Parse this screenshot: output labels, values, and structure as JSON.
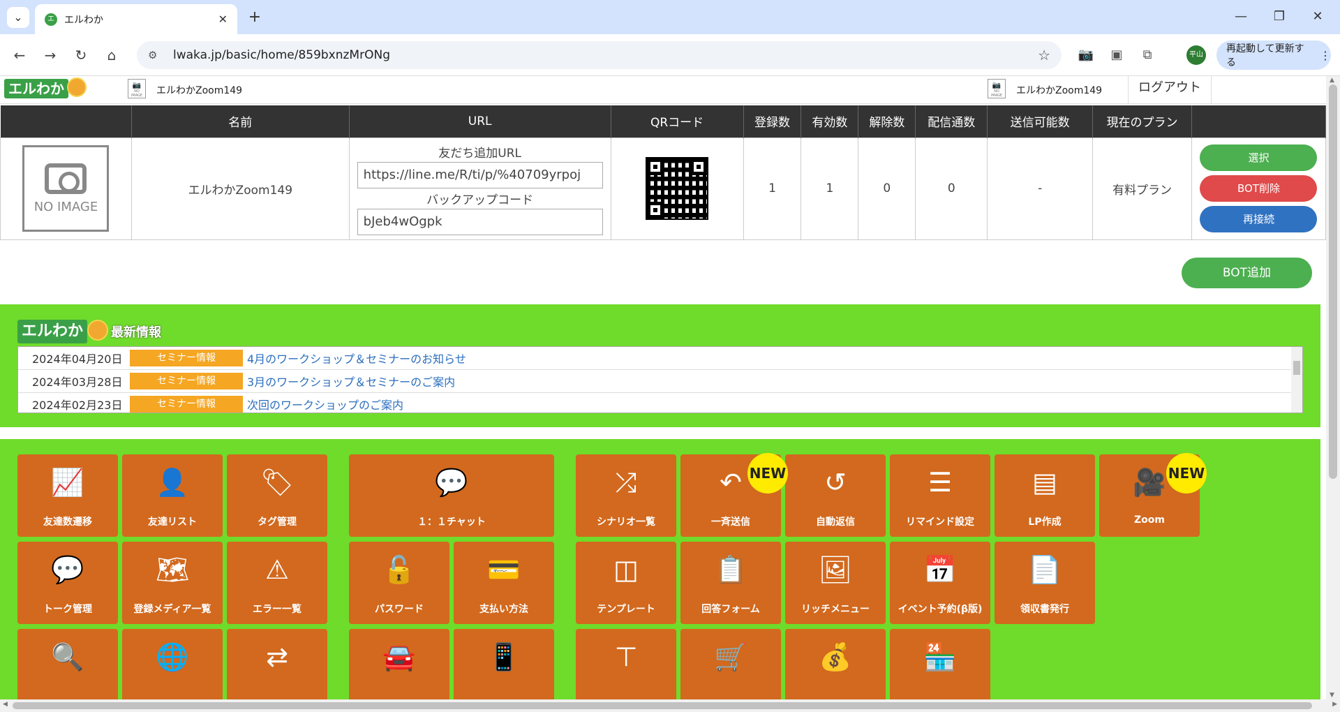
{
  "browser": {
    "tab_title": "エルわか",
    "tab_favicon": "エ",
    "url": "lwaka.jp/basic/home/859bxnzMrONg",
    "profile_initials": "平山",
    "relaunch_label": "再起動して更新する"
  },
  "header": {
    "logo_text": "エルわか",
    "account_name_left": "エルわかZoom149",
    "account_name_right": "エルわかZoom149",
    "noimage_label": "NO IMAGE",
    "logout_label": "ログアウト"
  },
  "bots_table": {
    "columns": [
      "",
      "名前",
      "URL",
      "QRコード",
      "登録数",
      "有効数",
      "解除数",
      "配信通数",
      "送信可能数",
      "現在のプラン",
      ""
    ],
    "row": {
      "image_label": "NO IMAGE",
      "name": "エルわかZoom149",
      "friend_url_label": "友だち追加URL",
      "friend_url": "https://line.me/R/ti/p/%40709yrpoj",
      "backup_label": "バックアップコード",
      "backup_code": "bJeb4wOgpk",
      "registered": "1",
      "active": "1",
      "unsubscribed": "0",
      "delivered": "0",
      "sendable": "-",
      "plan": "有料プラン",
      "select_label": "選択",
      "delete_label": "BOT削除",
      "reconnect_label": "再接続"
    },
    "add_bot_label": "BOT追加"
  },
  "news": {
    "logo_text": "エルわか",
    "heading": "最新情報",
    "items": [
      {
        "date": "2024年04月20日",
        "tag": "セミナー情報",
        "title": "4月のワークショップ＆セミナーのお知らせ"
      },
      {
        "date": "2024年03月28日",
        "tag": "セミナー情報",
        "title": "3月のワークショップ＆セミナーのご案内"
      },
      {
        "date": "2024年02月23日",
        "tag": "セミナー情報",
        "title": "次回のワークショップのご案内"
      }
    ]
  },
  "menu": {
    "new_badge": "NEW",
    "tiles": [
      {
        "label": "友達数遷移",
        "icon": "chart-line-icon",
        "glyph": "📈"
      },
      {
        "label": "友達リスト",
        "icon": "user-icon",
        "glyph": "👤"
      },
      {
        "label": "タグ管理",
        "icon": "tags-icon",
        "glyph": "🏷"
      },
      {
        "label": "１：１チャット",
        "icon": "chat-bubble-icon",
        "glyph": "💬"
      },
      {
        "label": "シナリオ一覧",
        "icon": "shuffle-icon",
        "glyph": "⤮"
      },
      {
        "label": "一斉送信",
        "icon": "reply-icon",
        "glyph": "↶"
      },
      {
        "label": "自動返信",
        "icon": "undo-icon",
        "glyph": "↺"
      },
      {
        "label": "リマインド設定",
        "icon": "list-icon",
        "glyph": "☰"
      },
      {
        "label": "LP作成",
        "icon": "webpage-icon",
        "glyph": "▤"
      },
      {
        "label": "Zoom",
        "icon": "video-camera-icon",
        "glyph": "🎥"
      },
      {
        "label": "トーク管理",
        "icon": "comment-icon",
        "glyph": "💬"
      },
      {
        "label": "登録メディア一覧",
        "icon": "map-icon",
        "glyph": "🗺"
      },
      {
        "label": "エラー一覧",
        "icon": "warning-icon",
        "glyph": "⚠"
      },
      {
        "label": "パスワード",
        "icon": "unlock-icon",
        "glyph": "🔓"
      },
      {
        "label": "支払い方法",
        "icon": "credit-card-icon",
        "glyph": "💳"
      },
      {
        "label": "テンプレート",
        "icon": "columns-icon",
        "glyph": "◫"
      },
      {
        "label": "回答フォーム",
        "icon": "clipboard-icon",
        "glyph": "📋"
      },
      {
        "label": "リッチメニュー",
        "icon": "image-icon",
        "glyph": "🖼"
      },
      {
        "label": "イベント予約(β版)",
        "icon": "calendar-icon",
        "glyph": "📅"
      },
      {
        "label": "領収書発行",
        "icon": "document-icon",
        "glyph": "📄"
      },
      {
        "label": "",
        "icon": "search-user-icon",
        "glyph": "🔍"
      },
      {
        "label": "",
        "icon": "www-icon",
        "glyph": "🌐"
      },
      {
        "label": "",
        "icon": "exchange-icon",
        "glyph": "⇄"
      },
      {
        "label": "",
        "icon": "car-icon",
        "glyph": "🚘"
      },
      {
        "label": "",
        "icon": "mobile-icon",
        "glyph": "📱"
      },
      {
        "label": "",
        "icon": "sitemap-icon",
        "glyph": "⊤"
      },
      {
        "label": "",
        "icon": "cart-icon",
        "glyph": "🛒"
      },
      {
        "label": "",
        "icon": "money-bag-icon",
        "glyph": "💰"
      },
      {
        "label": "",
        "icon": "store-icon",
        "glyph": "🏪"
      }
    ]
  }
}
